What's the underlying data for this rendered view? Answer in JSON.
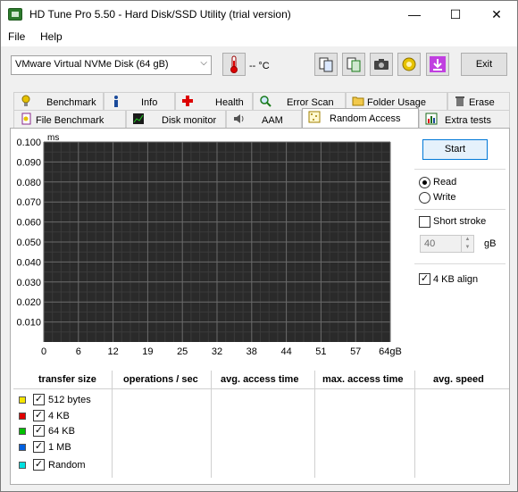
{
  "window": {
    "title": "HD Tune Pro 5.50 - Hard Disk/SSD Utility (trial version)",
    "minimize": "—",
    "maximize": "☐",
    "close": "✕"
  },
  "menu": {
    "file": "File",
    "help": "Help"
  },
  "toolbar": {
    "disk": "VMware Virtual NVMe Disk (64 gB)",
    "temperature": "-- °C",
    "exit_label": "Exit"
  },
  "tabs_row1": [
    "Benchmark",
    "Info",
    "Health",
    "Error Scan",
    "Folder Usage",
    "Erase"
  ],
  "tabs_row2": [
    "File Benchmark",
    "Disk monitor",
    "AAM",
    "Random Access",
    "Extra tests"
  ],
  "active_tab": "Random Access",
  "controls": {
    "start_label": "Start",
    "read_label": "Read",
    "read_selected": true,
    "write_label": "Write",
    "short_stroke_label": "Short stroke",
    "short_stroke_checked": false,
    "stroke_value": "40",
    "stroke_unit": "gB",
    "align_label": "4 KB align",
    "align_checked": true
  },
  "chart_data": {
    "type": "scatter",
    "ylabel": "ms",
    "ylim": [
      0,
      0.1
    ],
    "y_ticks": [
      "0.100",
      "0.090",
      "0.080",
      "0.070",
      "0.060",
      "0.050",
      "0.040",
      "0.030",
      "0.020",
      "0.010"
    ],
    "x_ticks": [
      "0",
      "6",
      "12",
      "19",
      "25",
      "32",
      "38",
      "44",
      "51",
      "57",
      "64gB"
    ],
    "series": [],
    "grid": true,
    "colors": {
      "plot_bg": "#2a2a2a",
      "grid": "#6a6a6a"
    }
  },
  "results": {
    "headers": [
      "transfer size",
      "operations / sec",
      "avg. access time",
      "max. access time",
      "avg. speed"
    ],
    "rows": [
      {
        "label": "512 bytes",
        "color": "#f5e500",
        "checked": true
      },
      {
        "label": "4 KB",
        "color": "#e00000",
        "checked": true
      },
      {
        "label": "64 KB",
        "color": "#00c000",
        "checked": true
      },
      {
        "label": "1 MB",
        "color": "#0060e0",
        "checked": true
      },
      {
        "label": "Random",
        "color": "#00e0e0",
        "checked": true
      }
    ]
  }
}
